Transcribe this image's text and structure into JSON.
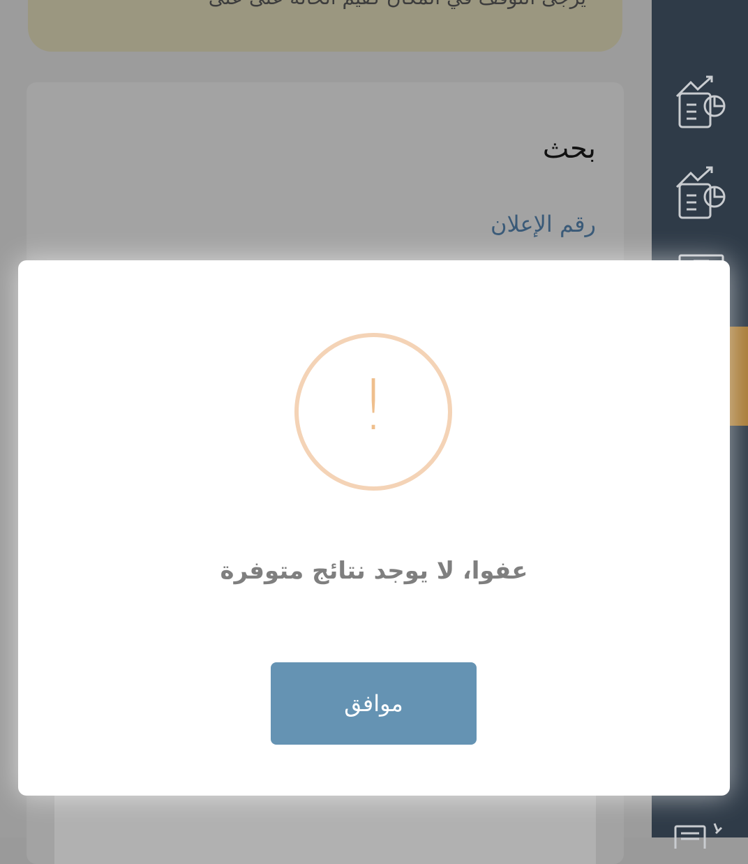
{
  "banner": {
    "text": "يرجى التوقف في المكان كقيم الحالة على على"
  },
  "search_panel": {
    "title": "بحث",
    "ad_number_label": "رقم الإعلان"
  },
  "sidebar": {
    "icons": [
      "report-chart-icon",
      "report-chart-icon",
      "certificate-icon",
      "document-edit-icon"
    ]
  },
  "alert_dialog": {
    "icon": "exclamation-icon",
    "icon_glyph": "!",
    "message": "عفوا، لا يوجد نتائج متوفرة",
    "ok_label": "موافق"
  },
  "colors": {
    "sidebar": "#2f3b48",
    "accent": "#a77a35",
    "button": "#6593b3",
    "warning": "#efbf8d"
  }
}
